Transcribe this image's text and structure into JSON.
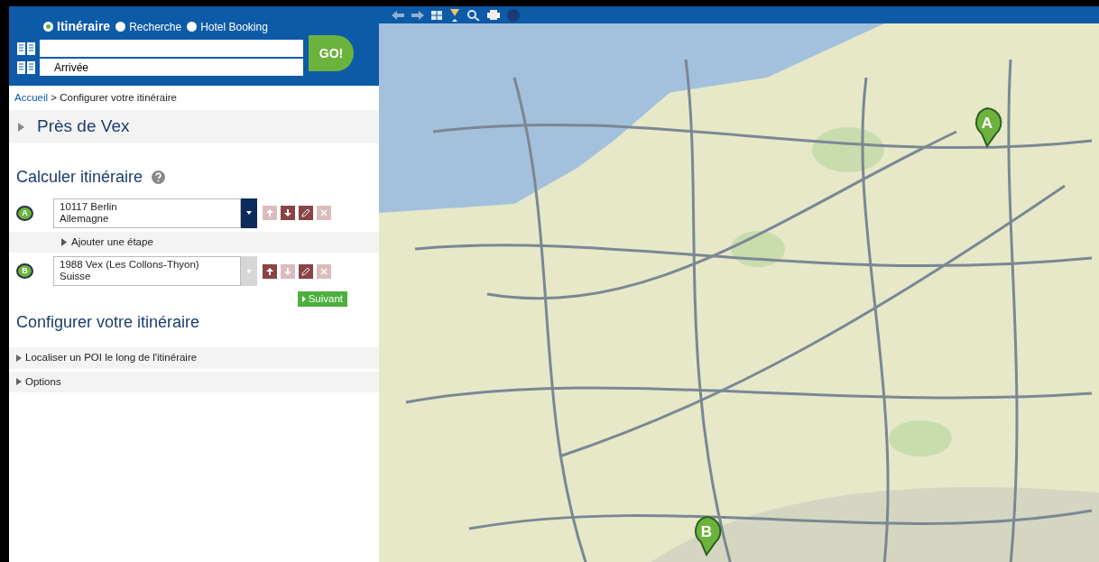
{
  "search_modes": [
    {
      "label": "Itinéraire",
      "selected": true
    },
    {
      "label": "Recherche",
      "selected": false
    },
    {
      "label": "Hotel Booking",
      "selected": false
    }
  ],
  "search_fields": [
    {
      "kind": "text"
    },
    {
      "kind": "text",
      "value": "Arrivée"
    }
  ],
  "go_button": "GO!",
  "breadcrumb": {
    "items": [
      "Accueil",
      "Configurer votre itinéraire"
    ],
    "separator": ">"
  },
  "section_title": "Près de Vex",
  "route_heading": "Calculer itinéraire",
  "waypoints": [
    {
      "marker": "A",
      "line1": "10117 Berlin",
      "line2": "Allemagne",
      "dropdown_enabled": true,
      "actions": [
        {
          "kind": "up",
          "enabled": false
        },
        {
          "kind": "down",
          "enabled": true
        },
        {
          "kind": "edit",
          "enabled": true
        },
        {
          "kind": "delete",
          "enabled": false
        }
      ]
    },
    {
      "marker": "B",
      "line1": "1988 Vex (Les Collons-Thyon)",
      "line2": "Suisse",
      "dropdown_enabled": false,
      "actions": [
        {
          "kind": "up",
          "enabled": true
        },
        {
          "kind": "down",
          "enabled": false
        },
        {
          "kind": "edit",
          "enabled": true
        },
        {
          "kind": "delete",
          "enabled": false
        }
      ]
    }
  ],
  "add_step": "Ajouter une étape",
  "next_button": "Suivant",
  "config_heading": "Configurer votre itinéraire",
  "accordion": [
    {
      "label": "Localiser un POI le long de l'itinéraire",
      "expanded": false
    },
    {
      "label": "Options",
      "expanded": false
    }
  ],
  "map": {
    "kind": "picture",
    "pins": [
      {
        "label": "A"
      },
      {
        "label": "B"
      }
    ]
  }
}
